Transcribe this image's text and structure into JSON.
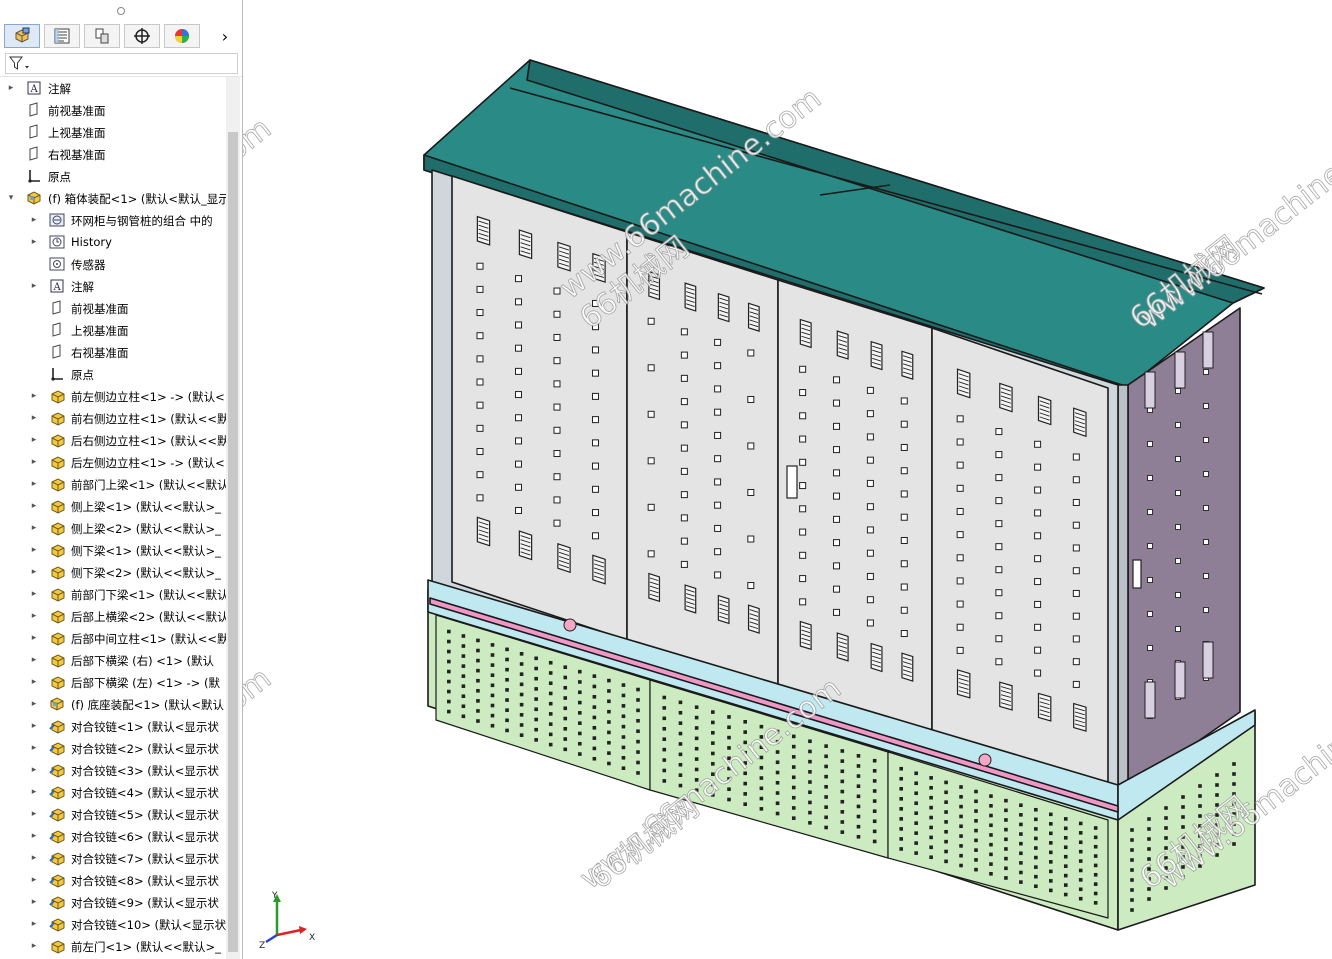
{
  "feature_tree": {
    "items": [
      {
        "label": "注解",
        "icon": "annotation-icon",
        "indent": 0,
        "expander": "▸"
      },
      {
        "label": "前视基准面",
        "icon": "plane-icon",
        "indent": 0,
        "expander": ""
      },
      {
        "label": "上视基准面",
        "icon": "plane-icon",
        "indent": 0,
        "expander": ""
      },
      {
        "label": "右视基准面",
        "icon": "plane-icon",
        "indent": 0,
        "expander": ""
      },
      {
        "label": "原点",
        "icon": "origin-icon",
        "indent": 0,
        "expander": ""
      },
      {
        "label": "(f) 箱体装配<1> (默认<默认_显示",
        "icon": "assembly-icon",
        "indent": 0,
        "expander": "▾"
      },
      {
        "label": "环网柜与钢管桩的组合 中的",
        "icon": "folder-icon",
        "indent": 1,
        "expander": "▸"
      },
      {
        "label": "History",
        "icon": "history-icon",
        "indent": 1,
        "expander": "▸"
      },
      {
        "label": "传感器",
        "icon": "sensor-icon",
        "indent": 1,
        "expander": ""
      },
      {
        "label": "注解",
        "icon": "annotation-icon",
        "indent": 1,
        "expander": "▸"
      },
      {
        "label": "前视基准面",
        "icon": "plane-icon",
        "indent": 1,
        "expander": ""
      },
      {
        "label": "上视基准面",
        "icon": "plane-icon",
        "indent": 1,
        "expander": ""
      },
      {
        "label": "右视基准面",
        "icon": "plane-icon",
        "indent": 1,
        "expander": ""
      },
      {
        "label": "原点",
        "icon": "origin-icon",
        "indent": 1,
        "expander": ""
      },
      {
        "label": "前左侧边立柱<1> -> (默认<",
        "icon": "part-icon",
        "indent": 1,
        "expander": "▸"
      },
      {
        "label": "前右侧边立柱<1> (默认<<默",
        "icon": "part-icon",
        "indent": 1,
        "expander": "▸"
      },
      {
        "label": "后右侧边立柱<1> (默认<<默",
        "icon": "part-icon",
        "indent": 1,
        "expander": "▸"
      },
      {
        "label": "后左侧边立柱<1> -> (默认<",
        "icon": "part-icon",
        "indent": 1,
        "expander": "▸"
      },
      {
        "label": "前部门上梁<1> (默认<<默认",
        "icon": "part-icon",
        "indent": 1,
        "expander": "▸"
      },
      {
        "label": "侧上梁<1> (默认<<默认>_",
        "icon": "part-icon",
        "indent": 1,
        "expander": "▸"
      },
      {
        "label": "侧上梁<2> (默认<<默认>_",
        "icon": "part-icon",
        "indent": 1,
        "expander": "▸"
      },
      {
        "label": "侧下梁<1> (默认<<默认>_",
        "icon": "part-icon",
        "indent": 1,
        "expander": "▸"
      },
      {
        "label": "侧下梁<2> (默认<<默认>_",
        "icon": "part-icon",
        "indent": 1,
        "expander": "▸"
      },
      {
        "label": "前部门下梁<1> (默认<<默认",
        "icon": "part-icon",
        "indent": 1,
        "expander": "▸"
      },
      {
        "label": "后部上横梁<2> (默认<<默认",
        "icon": "part-icon",
        "indent": 1,
        "expander": "▸"
      },
      {
        "label": "后部中间立柱<1> (默认<<默",
        "icon": "part-icon",
        "indent": 1,
        "expander": "▸"
      },
      {
        "label": "后部下横梁 (右) <1> (默认",
        "icon": "part-icon",
        "indent": 1,
        "expander": "▸"
      },
      {
        "label": "后部下横梁 (左) <1> -> (默",
        "icon": "part-icon",
        "indent": 1,
        "expander": "▸"
      },
      {
        "label": "(f) 底座装配<1> (默认<默认",
        "icon": "assembly-icon",
        "indent": 1,
        "expander": "▸"
      },
      {
        "label": "对合铰链<1> (默认<显示状",
        "icon": "hinge-part-icon",
        "indent": 1,
        "expander": "▸"
      },
      {
        "label": "对合铰链<2> (默认<显示状",
        "icon": "hinge-part-icon",
        "indent": 1,
        "expander": "▸"
      },
      {
        "label": "对合铰链<3> (默认<显示状",
        "icon": "hinge-part-icon",
        "indent": 1,
        "expander": "▸"
      },
      {
        "label": "对合铰链<4> (默认<显示状",
        "icon": "hinge-part-icon",
        "indent": 1,
        "expander": "▸"
      },
      {
        "label": "对合铰链<5> (默认<显示状",
        "icon": "hinge-part-icon",
        "indent": 1,
        "expander": "▸"
      },
      {
        "label": "对合铰链<6> (默认<显示状",
        "icon": "hinge-part-icon",
        "indent": 1,
        "expander": "▸"
      },
      {
        "label": "对合铰链<7> (默认<显示状",
        "icon": "hinge-part-icon",
        "indent": 1,
        "expander": "▸"
      },
      {
        "label": "对合铰链<8> (默认<显示状",
        "icon": "hinge-part-icon",
        "indent": 1,
        "expander": "▸"
      },
      {
        "label": "对合铰链<9> (默认<显示状",
        "icon": "hinge-part-icon",
        "indent": 1,
        "expander": "▸"
      },
      {
        "label": "对合铰链<10> (默认<显示状",
        "icon": "hinge-part-icon",
        "indent": 1,
        "expander": "▸"
      },
      {
        "label": "前左门<1> (默认<<默认>_",
        "icon": "part-icon",
        "indent": 1,
        "expander": "▸"
      }
    ]
  },
  "panel_tabs": [
    {
      "name": "feature-manager-tab",
      "icon": "cube-tree-icon"
    },
    {
      "name": "property-manager-tab",
      "icon": "property-list-icon"
    },
    {
      "name": "configuration-manager-tab",
      "icon": "configuration-icon"
    },
    {
      "name": "dimxpert-tab",
      "icon": "crosshair-icon"
    },
    {
      "name": "display-manager-tab",
      "icon": "appearance-ball-icon"
    }
  ],
  "panel_more": "›",
  "watermarks": {
    "text_url": "www.66machine.com",
    "text_cn": "66机械网"
  },
  "triad": {
    "x": "X",
    "y": "Y",
    "z": "Z"
  },
  "colors": {
    "roof": "#2a8a86",
    "roof_dark": "#1f6e6b",
    "door": "#e4e4e4",
    "side": "#8e7e96",
    "base_frame": "#bfe8f0",
    "base_pink": "#ef98c8",
    "base_panel": "#cdebc0",
    "outline": "#1a1a1a"
  }
}
